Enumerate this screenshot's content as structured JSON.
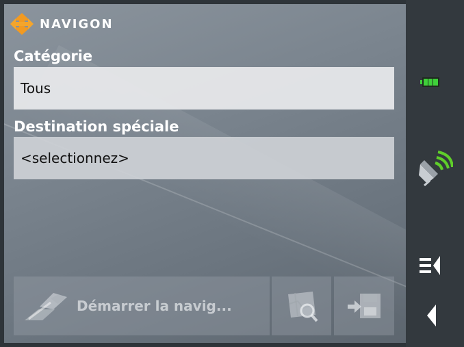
{
  "app": {
    "brand": "NAVIGON",
    "colors": {
      "brand_orange": "#f29a21",
      "battery_green": "#3fd13a",
      "gps_green": "#5fce2a"
    }
  },
  "form": {
    "category_label": "Catégorie",
    "category_value": "Tous",
    "destination_label": "Destination spéciale",
    "destination_value": "<selectionnez>"
  },
  "actions": {
    "start_navigation_label": "Démarrer la navig...",
    "show_map_icon": "map-search-icon",
    "save_destination_icon": "save-icon"
  },
  "status": {
    "battery_icon": "battery-icon",
    "battery_level": 1.0,
    "gps_icon": "gps-satellite-icon"
  },
  "navigation": {
    "menu_icon": "menu-back-icon",
    "back_icon": "back-arrow-icon"
  }
}
